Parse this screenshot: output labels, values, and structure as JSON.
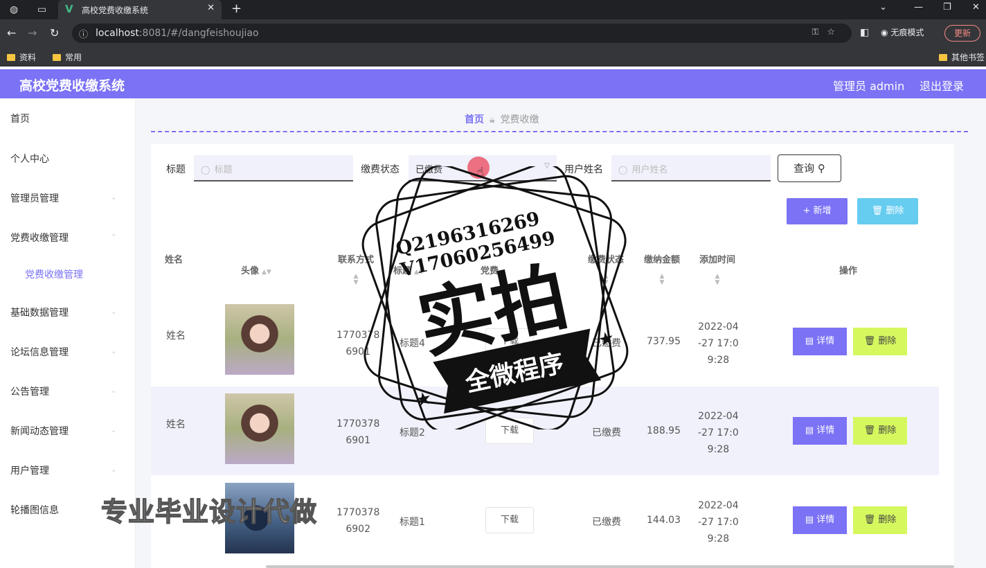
{
  "browser": {
    "tab_title": "高校党费收缴系统",
    "url_host": "localhost",
    "url_rest": ":8081/#/dangfeishoujiao",
    "incognito_label": "无痕模式",
    "update_label": "更新",
    "bookmarks": [
      "资料",
      "常用"
    ],
    "other_bookmarks": "其他书签"
  },
  "header": {
    "brand": "高校党费收缴系统",
    "admin": "管理员 admin",
    "logout": "退出登录"
  },
  "sidebar": {
    "items": [
      "首页",
      "个人中心",
      "管理员管理",
      "党费收缴管理",
      "党费收缴管理",
      "基础数据管理",
      "论坛信息管理",
      "公告管理",
      "新闻动态管理",
      "用户管理",
      "轮播图信息"
    ]
  },
  "breadcrumb": {
    "home": "首页",
    "current": "党费收缴"
  },
  "search": {
    "title_label": "标题",
    "title_placeholder": "标题",
    "status_label": "缴费状态",
    "status_value": "已缴费",
    "user_label": "用户姓名",
    "user_placeholder": "用户姓名",
    "query_button": "查询"
  },
  "actions": {
    "add": "新增",
    "delete": "删除"
  },
  "table": {
    "headers": [
      "姓名",
      "头像",
      "联系方式",
      "标题",
      "党费",
      "缴费状态",
      "缴纳金额",
      "添加时间",
      "操作"
    ],
    "rows": [
      {
        "name": "姓名",
        "phone_a": "1770378",
        "phone_b": "6901",
        "title": "标题4",
        "file": "下载",
        "status": "已缴费",
        "amount": "737.95",
        "time_a": "2022-04",
        "time_b": "-27 17:0",
        "time_c": "9:28",
        "detail": "详情",
        "delete": "删除"
      },
      {
        "name": "姓名",
        "phone_a": "1770378",
        "phone_b": "6901",
        "title": "标题2",
        "file": "下载",
        "status": "已缴费",
        "amount": "188.95",
        "time_a": "2022-04",
        "time_b": "-27 17:0",
        "time_c": "9:28",
        "detail": "详情",
        "delete": "删除"
      },
      {
        "name": "",
        "phone_a": "1770378",
        "phone_b": "6902",
        "title": "标题1",
        "file": "下载",
        "status": "已缴费",
        "amount": "144.03",
        "time_a": "2022-04",
        "time_b": "-27 17:0",
        "time_c": "9:28",
        "detail": "详情",
        "delete": "删除"
      }
    ]
  },
  "watermark": {
    "qq": "Q2196316269",
    "vx": "V17060256499",
    "big": "实拍",
    "band": "全微程序",
    "bottom": "专业毕业设计代做"
  },
  "colors": {
    "accent": "#7b72f5",
    "delete_light": "#d5f85e",
    "delete_blue": "#66ccf0"
  }
}
